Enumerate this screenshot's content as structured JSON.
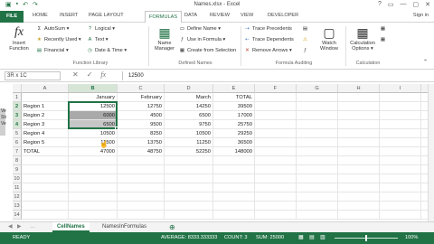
{
  "window": {
    "title": "Names.xlsx - Excel",
    "qat_icons": [
      "excel-logo-icon",
      "save-icon",
      "undo-icon",
      "redo-icon"
    ],
    "controls": [
      "?",
      "▭",
      "—",
      "▢",
      "✕"
    ]
  },
  "tabs": [
    "FILE",
    "HOME",
    "INSERT",
    "PAGE LAYOUT",
    "FORMULAS",
    "DATA",
    "REVIEW",
    "VIEW",
    "DEVELOPER"
  ],
  "active_tab": "FORMULAS",
  "signin": "Sign in",
  "ribbon": {
    "insert_function": "Insert\nFunction",
    "library": [
      {
        "label": "AutoSum ▾",
        "icon": "Σ"
      },
      {
        "label": "Recently Used ▾",
        "icon": "★"
      },
      {
        "label": "Financial ▾",
        "icon": "▤"
      },
      {
        "label": "Logical ▾",
        "icon": "?"
      },
      {
        "label": "Text ▾",
        "icon": "A"
      },
      {
        "label": "Date & Time ▾",
        "icon": "◷"
      }
    ],
    "library_group": "Function Library",
    "name_manager": "Name\nManager",
    "define_name": "Define Name ▾",
    "use_in_formula": "Use in Formula ▾",
    "create_from_selection": "Create from Selection",
    "names_group": "Defined Names",
    "trace_precedents": "Trace Precedents",
    "trace_dependents": "Trace Dependents",
    "remove_arrows": "Remove Arrows ▾",
    "watch_window": "Watch\nWindow",
    "auditing_group": "Formula Auditing",
    "calc_options": "Calculation\nOptions ▾",
    "calc_group": "Calculation"
  },
  "formula_bar": {
    "name_box": "3R x 1C",
    "value": "12500"
  },
  "columns": [
    "A",
    "B",
    "C",
    "D",
    "E",
    "F",
    "G",
    "H",
    "I",
    "J"
  ],
  "selected_column": "B",
  "rows": [
    [
      "",
      "January",
      "February",
      "March",
      "TOTAL"
    ],
    [
      "Region 1",
      "12500",
      "12750",
      "14250",
      "39500"
    ],
    [
      "Region 2",
      "6000",
      "4500",
      "6500",
      "17000"
    ],
    [
      "Region 3",
      "6500",
      "9500",
      "9750",
      "25750"
    ],
    [
      "Region 4",
      "10500",
      "8250",
      "10500",
      "29250"
    ],
    [
      "Region 5",
      "11500",
      "13750",
      "11250",
      "36500"
    ],
    [
      "TOTAL",
      "47000",
      "48750",
      "52250",
      "148000"
    ]
  ],
  "row_numbers": [
    "1",
    "2",
    "3",
    "4",
    "5",
    "6",
    "7",
    "8",
    "9",
    "10",
    "11",
    "12",
    "13",
    "14"
  ],
  "selected_rows": [
    "2",
    "3",
    "4"
  ],
  "sheets": [
    "CellNames",
    "NamesInFormulas"
  ],
  "active_sheet": "CellNames",
  "status": {
    "ready": "READY",
    "average": "AVERAGE: 8333.333333",
    "count": "COUNT: 3",
    "sum": "SUM: 25000",
    "zoom": "100%"
  },
  "left_peek": [
    "Ve",
    "Sti",
    "Ve"
  ],
  "accent_color": "#217346"
}
